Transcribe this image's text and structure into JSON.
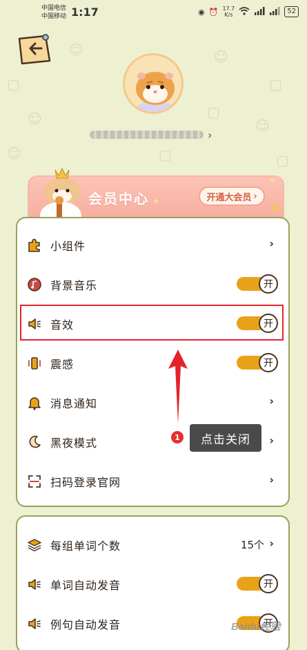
{
  "status_bar": {
    "carrier1": "中国电信",
    "carrier2": "中国移动",
    "time": "1:17",
    "net_speed_value": "17.7",
    "net_speed_unit": "K/s",
    "battery": "52"
  },
  "profile": {
    "username_arrow": "›"
  },
  "vip_banner": {
    "title": "会员中心",
    "button_label": "开通大会员",
    "button_arrow": "›"
  },
  "settings_card_1": {
    "rows": [
      {
        "label": "小组件",
        "type": "chevron",
        "icon": "puzzle-icon"
      },
      {
        "label": "背景音乐",
        "type": "toggle",
        "toggle_text": "开",
        "icon": "music-icon"
      },
      {
        "label": "音效",
        "type": "toggle",
        "toggle_text": "开",
        "icon": "speaker-icon"
      },
      {
        "label": "震感",
        "type": "toggle",
        "toggle_text": "开",
        "icon": "vibrate-icon"
      },
      {
        "label": "消息通知",
        "type": "chevron",
        "icon": "bell-icon"
      },
      {
        "label": "黑夜模式",
        "type": "chevron",
        "icon": "moon-icon"
      },
      {
        "label": "扫码登录官网",
        "type": "chevron",
        "icon": "scan-icon"
      }
    ]
  },
  "settings_card_2": {
    "rows": [
      {
        "label": "每组单词个数",
        "type": "value",
        "value": "15个",
        "icon": "layers-icon"
      },
      {
        "label": "单词自动发音",
        "type": "toggle",
        "toggle_text": "开",
        "icon": "speaker-icon"
      },
      {
        "label": "例句自动发音",
        "type": "toggle",
        "toggle_text": "开",
        "icon": "speaker-icon"
      }
    ]
  },
  "chevron_glyph": "›",
  "annotation": {
    "step_number": "1",
    "tooltip_text": "点击关闭"
  },
  "watermark": "Baidu经验",
  "colors": {
    "background": "#eef0d2",
    "card_border": "#9ba05a",
    "toggle_on": "#e8a21a",
    "highlight": "#e2242a",
    "vip_pink": "#f6a99b"
  }
}
